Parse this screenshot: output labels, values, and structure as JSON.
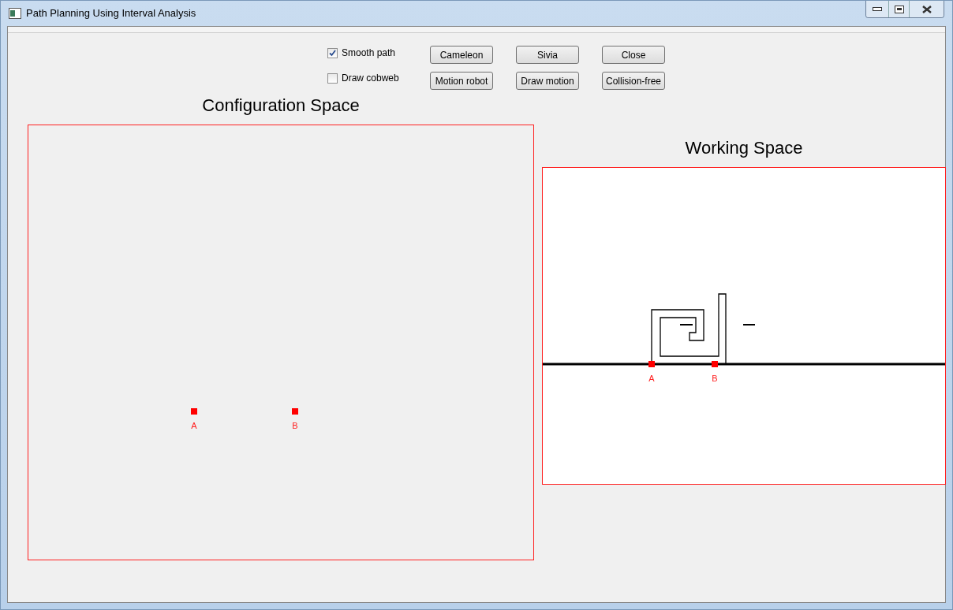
{
  "window": {
    "title": "Path Planning Using Interval Analysis"
  },
  "options": [
    {
      "label": "Smooth path",
      "checked": true
    },
    {
      "label": "Draw cobweb",
      "checked": false
    }
  ],
  "buttons": [
    [
      "Cameleon",
      "Sivia",
      "Close"
    ],
    [
      "Motion robot",
      "Draw motion",
      "Collision-free"
    ]
  ],
  "configuration_space": {
    "title": "Configuration Space",
    "points": [
      "A",
      "B"
    ]
  },
  "working_space": {
    "title": "Working Space",
    "points": [
      "A",
      "B"
    ]
  }
}
